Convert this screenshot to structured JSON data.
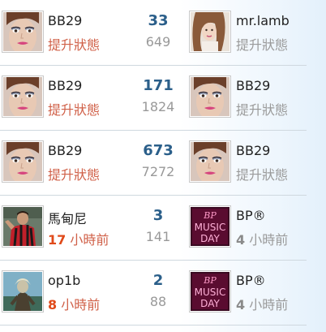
{
  "colors": {
    "status_active": "#d06048",
    "status_muted": "#9a9a9a",
    "count": "#2b5f8a"
  },
  "rows": [
    {
      "left": {
        "avatar": "woman-portrait",
        "name": "BB29",
        "status_prefix": "",
        "status_text": "提升狀態"
      },
      "count": "33",
      "sub": "649",
      "right": {
        "avatar": "woman-portrait-2",
        "name": "mr.lamb",
        "status_prefix": "",
        "status_text": "提升狀態"
      }
    },
    {
      "left": {
        "avatar": "woman-portrait",
        "name": "BB29",
        "status_prefix": "",
        "status_text": "提升狀態"
      },
      "count": "171",
      "sub": "1824",
      "right": {
        "avatar": "woman-portrait",
        "name": "BB29",
        "status_prefix": "",
        "status_text": "提升狀態"
      }
    },
    {
      "left": {
        "avatar": "woman-portrait",
        "name": "BB29",
        "status_prefix": "",
        "status_text": "提升狀態"
      },
      "count": "673",
      "sub": "7272",
      "right": {
        "avatar": "woman-portrait",
        "name": "BB29",
        "status_prefix": "",
        "status_text": "提升狀態"
      }
    },
    {
      "left": {
        "avatar": "footballer-photo",
        "name": "馬甸尼",
        "status_prefix": "17",
        "status_text": " 小時前"
      },
      "count": "3",
      "sub": "141",
      "right": {
        "avatar": "music-day-logo",
        "name": "BP®",
        "status_prefix": "4",
        "status_text": " 小時前"
      }
    },
    {
      "left": {
        "avatar": "figure-photo",
        "name": "op1b",
        "status_prefix": "8",
        "status_text": " 小時前"
      },
      "count": "2",
      "sub": "88",
      "right": {
        "avatar": "music-day-logo",
        "name": "BP®",
        "status_prefix": "4",
        "status_text": " 小時前"
      }
    }
  ]
}
